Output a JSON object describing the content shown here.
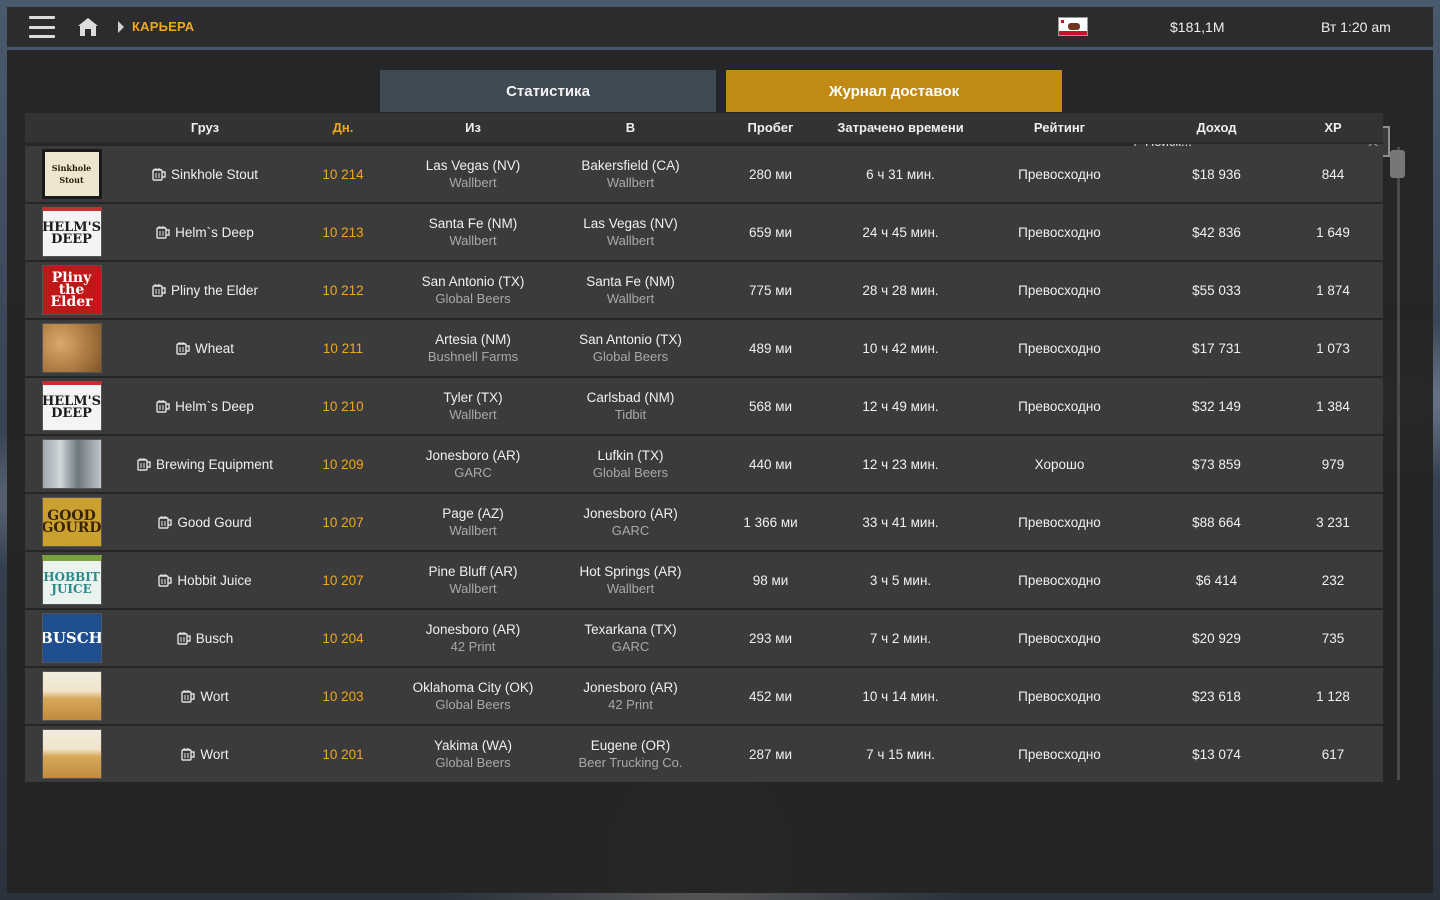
{
  "topbar": {
    "breadcrumb": "КАРЬЕРА",
    "money": "$181,1M",
    "clock": "Вт 1:20 am",
    "flag": "california-flag"
  },
  "tabs": {
    "stats": "Статистика",
    "log": "Журнал доставок"
  },
  "search": {
    "placeholder": "Поиск..."
  },
  "colors": {
    "accent": "#f0a71c",
    "active_tab": "#c08a14",
    "inactive_tab": "#3f4a55"
  },
  "table": {
    "headers": {
      "cargo": "Груз",
      "day": "Дн.",
      "from": "Из",
      "to": "В",
      "distance": "Пробег",
      "time": "Затрачено времени",
      "rating": "Рейтинг",
      "income": "Доход",
      "xp": "XP"
    },
    "rows": [
      {
        "thumb": "Sinkhole Stout",
        "cargo": "Sinkhole Stout",
        "day": "10 214",
        "from_city": "Las Vegas (NV)",
        "from_company": "Wallbert",
        "to_city": "Bakersfield (CA)",
        "to_company": "Wallbert",
        "distance": "280 ми",
        "time": "6 ч 31 мин.",
        "rating": "Превосходно",
        "income": "$18 936",
        "xp": "844"
      },
      {
        "thumb": "HELM'S DEEP",
        "cargo": "Helm`s Deep",
        "day": "10 213",
        "from_city": "Santa Fe (NM)",
        "from_company": "Wallbert",
        "to_city": "Las Vegas (NV)",
        "to_company": "Wallbert",
        "distance": "659 ми",
        "time": "24 ч 45 мин.",
        "rating": "Превосходно",
        "income": "$42 836",
        "xp": "1 649"
      },
      {
        "thumb": "Pliny the Elder",
        "cargo": "Pliny the Elder",
        "day": "10 212",
        "from_city": "San Antonio (TX)",
        "from_company": "Global Beers",
        "to_city": "Santa Fe (NM)",
        "to_company": "Wallbert",
        "distance": "775 ми",
        "time": "28 ч 28 мин.",
        "rating": "Превосходно",
        "income": "$55 033",
        "xp": "1 874"
      },
      {
        "thumb": "",
        "cargo": "Wheat",
        "day": "10 211",
        "from_city": "Artesia (NM)",
        "from_company": "Bushnell Farms",
        "to_city": "San Antonio (TX)",
        "to_company": "Global Beers",
        "distance": "489 ми",
        "time": "10 ч 42 мин.",
        "rating": "Превосходно",
        "income": "$17 731",
        "xp": "1 073"
      },
      {
        "thumb": "HELM'S DEEP",
        "cargo": "Helm`s Deep",
        "day": "10 210",
        "from_city": "Tyler (TX)",
        "from_company": "Wallbert",
        "to_city": "Carlsbad (NM)",
        "to_company": "Tidbit",
        "distance": "568 ми",
        "time": "12 ч 49 мин.",
        "rating": "Превосходно",
        "income": "$32 149",
        "xp": "1 384"
      },
      {
        "thumb": "",
        "cargo": "Brewing Equipment",
        "day": "10 209",
        "from_city": "Jonesboro (AR)",
        "from_company": "GARC",
        "to_city": "Lufkin (TX)",
        "to_company": "Global Beers",
        "distance": "440 ми",
        "time": "12 ч 23 мин.",
        "rating": "Хорошо",
        "income": "$73 859",
        "xp": "979"
      },
      {
        "thumb": "GOOD GOURD",
        "cargo": "Good Gourd",
        "day": "10 207",
        "from_city": "Page (AZ)",
        "from_company": "Wallbert",
        "to_city": "Jonesboro (AR)",
        "to_company": "GARC",
        "distance": "1 366 ми",
        "time": "33 ч 41 мин.",
        "rating": "Превосходно",
        "income": "$88 664",
        "xp": "3 231"
      },
      {
        "thumb": "HOBBIT JUICE",
        "cargo": "Hobbit Juice",
        "day": "10 207",
        "from_city": "Pine Bluff (AR)",
        "from_company": "Wallbert",
        "to_city": "Hot Springs (AR)",
        "to_company": "Wallbert",
        "distance": "98 ми",
        "time": "3 ч 5 мин.",
        "rating": "Превосходно",
        "income": "$6 414",
        "xp": "232"
      },
      {
        "thumb": "BUSCH",
        "cargo": "Busch",
        "day": "10 204",
        "from_city": "Jonesboro (AR)",
        "from_company": "42 Print",
        "to_city": "Texarkana (TX)",
        "to_company": "GARC",
        "distance": "293 ми",
        "time": "7 ч 2 мин.",
        "rating": "Превосходно",
        "income": "$20 929",
        "xp": "735"
      },
      {
        "thumb": "",
        "cargo": "Wort",
        "day": "10 203",
        "from_city": "Oklahoma City (OK)",
        "from_company": "Global Beers",
        "to_city": "Jonesboro (AR)",
        "to_company": "42 Print",
        "distance": "452 ми",
        "time": "10 ч 14 мин.",
        "rating": "Превосходно",
        "income": "$23 618",
        "xp": "1 128"
      },
      {
        "thumb": "",
        "cargo": "Wort",
        "day": "10 201",
        "from_city": "Yakima (WA)",
        "from_company": "Global Beers",
        "to_city": "Eugene (OR)",
        "to_company": "Beer Trucking Co.",
        "distance": "287 ми",
        "time": "7 ч 15 мин.",
        "rating": "Превосходно",
        "income": "$13 074",
        "xp": "617"
      }
    ]
  }
}
